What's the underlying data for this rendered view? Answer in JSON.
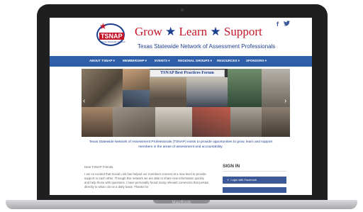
{
  "header": {
    "logo_text": "TSNAP",
    "logo_subtext": "Texas Statewide Network of Assessment Professionals",
    "tagline_grow": "Grow",
    "tagline_learn": "Learn",
    "tagline_support": "Support",
    "tagline_star": "★",
    "org_name": "Texas Statewide Network of Assessment Professionals",
    "social_facebook": "f",
    "social_twitter": "🐦"
  },
  "nav": {
    "items": [
      {
        "label": "ABOUT TSNAP ▾"
      },
      {
        "label": "MEMBERSHIP ▾"
      },
      {
        "label": "EVENTS ▾"
      },
      {
        "label": "REGIONAL GROUPS ▾"
      },
      {
        "label": "RESOURCES ▾"
      },
      {
        "label": "SPONSORS ▾"
      }
    ]
  },
  "banner": {
    "title": "TSNAP Best Practices Forum",
    "prev_arrow": "‹",
    "next_arrow": "›"
  },
  "intro": {
    "text": "Texas Statewide Network of Assessment Professionals (TSNAP) exists to provide opportunities to grow, learn and support members in the areas of assessment and accountability."
  },
  "letter": {
    "greeting": "Dear TSNAP Friends,",
    "body": "I am so excited that Social Link has helped our members connect at a new level to provide support to each other. Through this network we are able to share new information quickly and help those with questions. I have personally found many relevant comments that pertain directly to what I do on a daily basis. Thanks for"
  },
  "signin": {
    "title": "SIGN IN",
    "facebook_label": "Login with Facebook"
  },
  "device": {
    "brand": "MacBook"
  },
  "colors": {
    "brand_red": "#c6162b",
    "brand_blue": "#1d3f8f",
    "nav_blue": "#2e5fa8",
    "facebook_blue": "#3b5998"
  }
}
